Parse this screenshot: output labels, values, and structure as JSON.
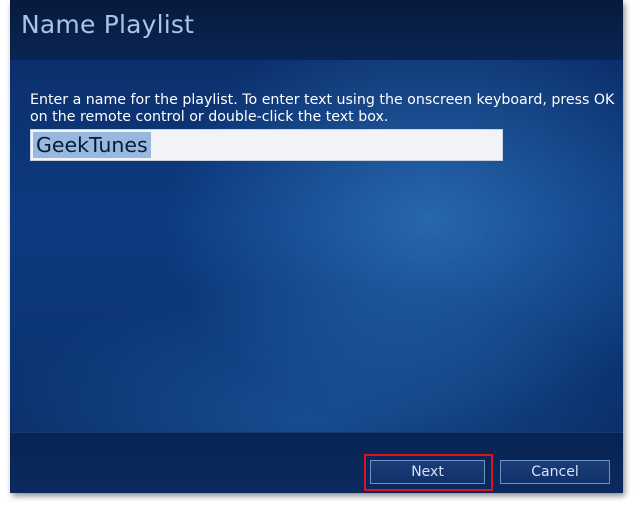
{
  "dialog": {
    "title": "Name Playlist",
    "instructions": "Enter a name for the playlist. To enter text using the onscreen keyboard, press OK on the remote control or double-click the text box.",
    "playlist_name": "GeekTunes"
  },
  "buttons": {
    "next": "Next",
    "cancel": "Cancel"
  },
  "colors": {
    "background": "#0b3575",
    "title_text": "#a9c4e6",
    "selection": "#97b8df",
    "highlight_border": "#d8141e"
  }
}
